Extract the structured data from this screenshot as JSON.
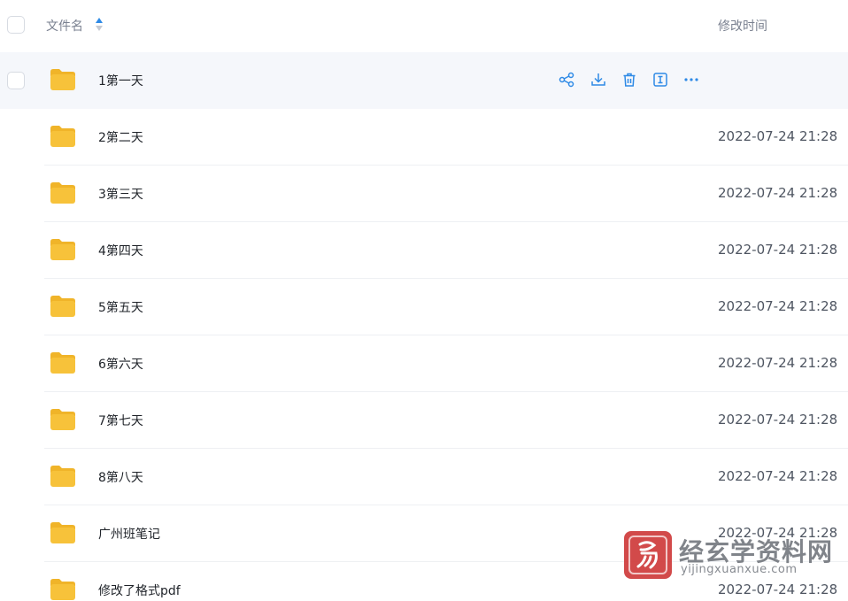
{
  "header": {
    "name_label": "文件名",
    "time_label": "修改时间"
  },
  "colors": {
    "folder": "#f7c23a",
    "accent": "#2e8ae6",
    "hover_row": "#f5f7fb",
    "watermark_seal": "#cf3b3b"
  },
  "rows": [
    {
      "name": "1第一天",
      "time": ""
    },
    {
      "name": "2第二天",
      "time": "2022-07-24 21:28"
    },
    {
      "name": "3第三天",
      "time": "2022-07-24 21:28"
    },
    {
      "name": "4第四天",
      "time": "2022-07-24 21:28"
    },
    {
      "name": "5第五天",
      "time": "2022-07-24 21:28"
    },
    {
      "name": "6第六天",
      "time": "2022-07-24 21:28"
    },
    {
      "name": "7第七天",
      "time": "2022-07-24 21:28"
    },
    {
      "name": "8第八天",
      "time": "2022-07-24 21:28"
    },
    {
      "name": "广州班笔记",
      "time": "2022-07-24 21:28"
    },
    {
      "name": "修改了格式pdf",
      "time": "2022-07-24 21:28"
    }
  ],
  "row_actions": [
    "share-icon",
    "download-icon",
    "delete-icon",
    "rename-icon",
    "more-icon"
  ],
  "watermark": {
    "title": "经玄学资料网",
    "subtitle": "yijingxuanxue.com"
  }
}
